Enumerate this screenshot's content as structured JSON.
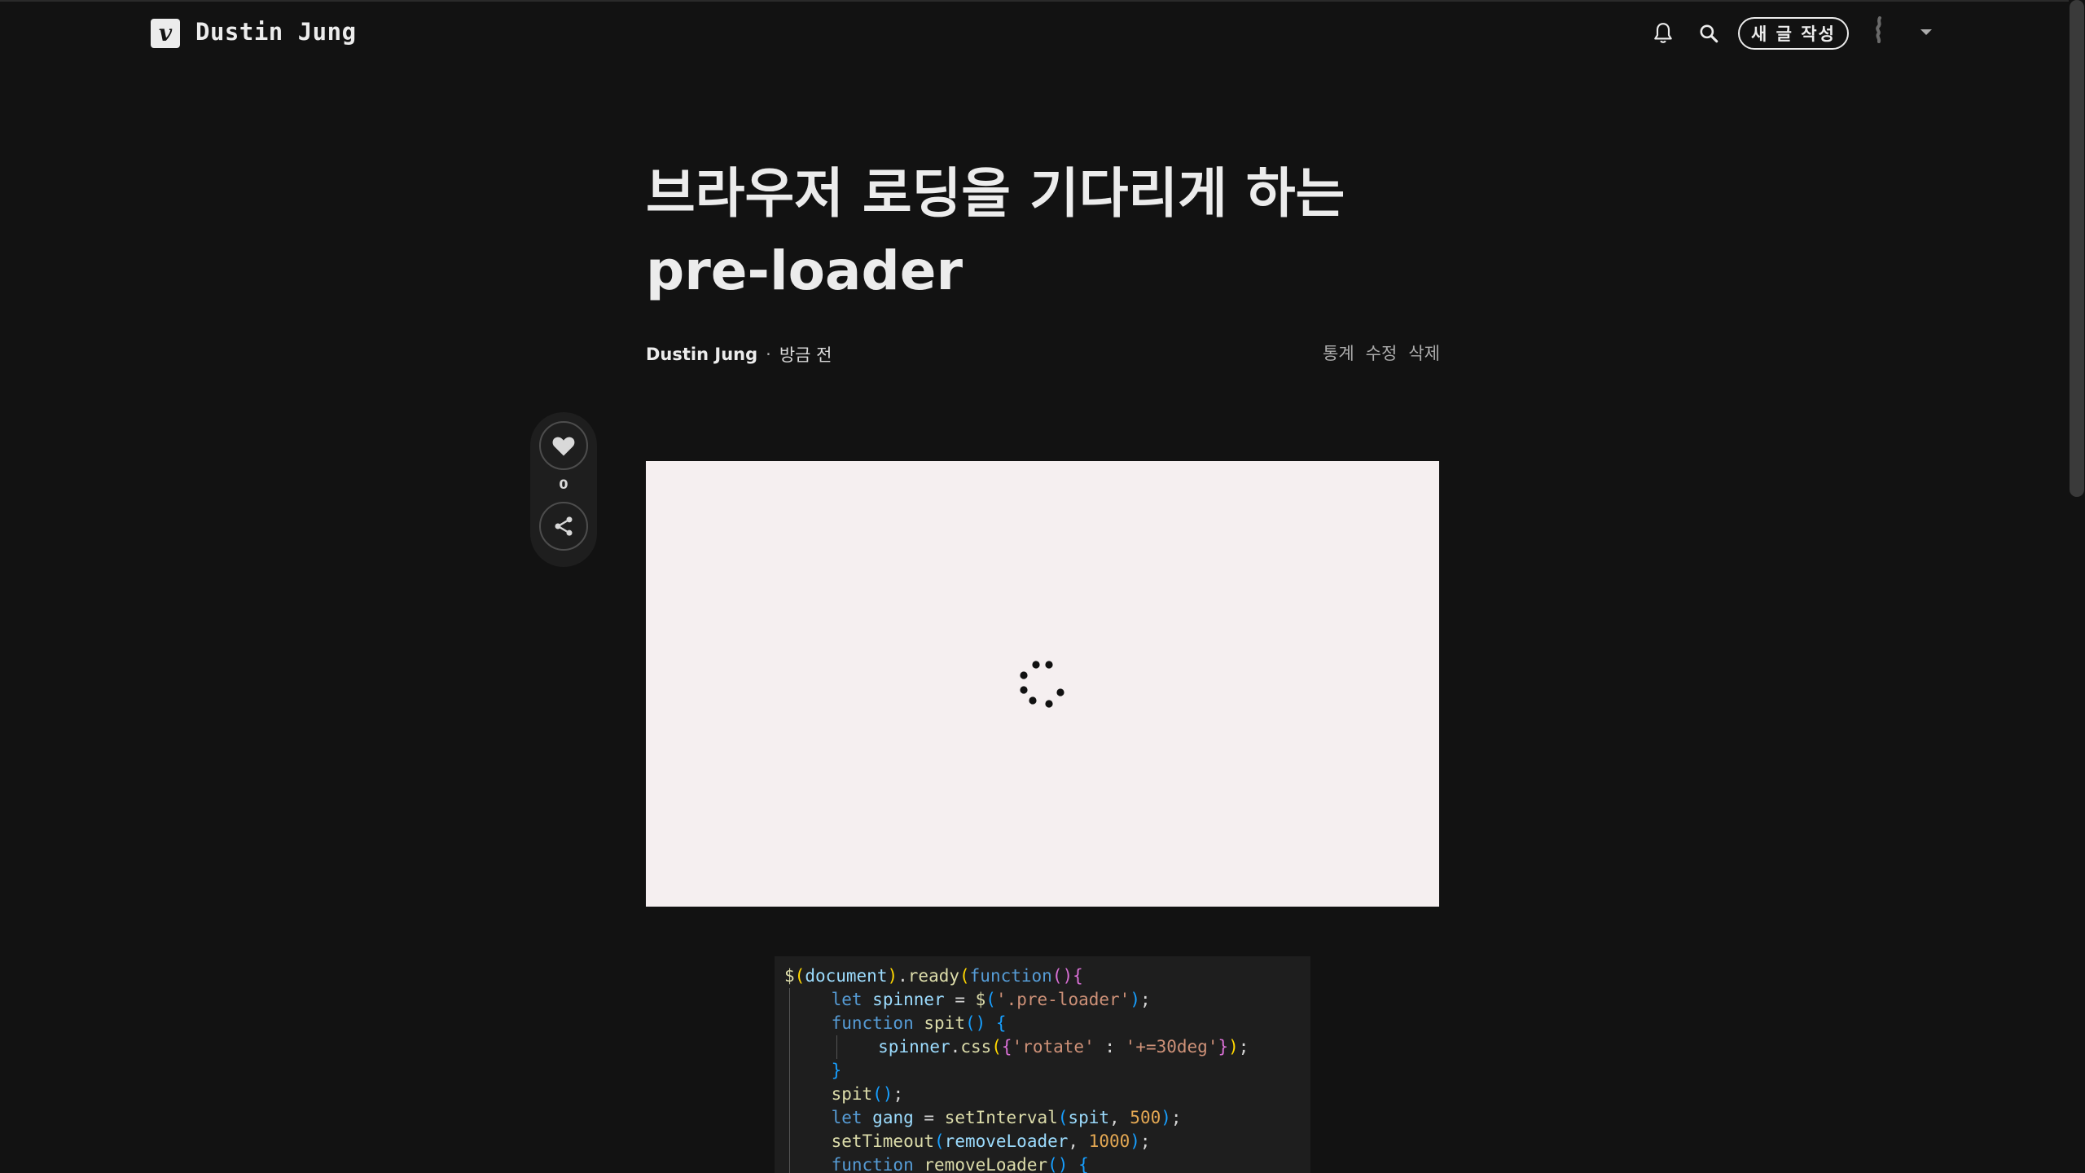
{
  "header": {
    "logo_letter": "v",
    "blog_name": "Dustin Jung",
    "write_button": "새 글 작성",
    "icons": [
      "bell-icon",
      "search-icon",
      "caret-down-icon"
    ]
  },
  "post": {
    "title": "브라우저 로딩을 기다리게 하는 pre-loader",
    "author": "Dustin Jung",
    "separator": "·",
    "time": "방금 전",
    "actions": {
      "stats": "통계",
      "edit": "수정",
      "delete": "삭제"
    }
  },
  "side_panel": {
    "like_count": "0",
    "icons": [
      "heart-icon",
      "share-icon"
    ]
  },
  "code": {
    "language": "javascript",
    "lines": [
      "$(document).ready(function(){",
      "    let spinner = $('.pre-loader');",
      "    function spit() {",
      "        spinner.css({'rotate' : '+=30deg'});",
      "    }",
      "    spit();",
      "    let gang = setInterval(spit, 500);",
      "    setTimeout(removeLoader, 1000);",
      "    function removeLoader() {"
    ]
  },
  "colors": {
    "background": "#121212",
    "text": "#ececec",
    "preview_background": "#f5eff0",
    "code_background": "#1e1e1e"
  }
}
